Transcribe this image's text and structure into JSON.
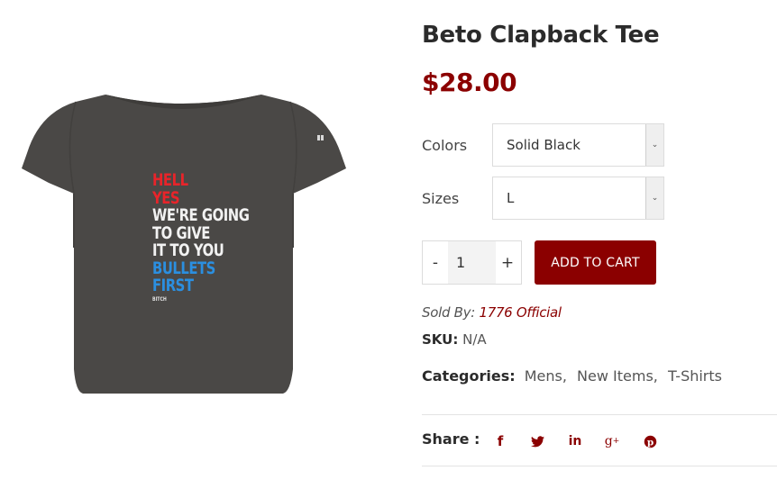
{
  "product": {
    "title": "Beto Clapback Tee",
    "price": "$28.00",
    "shirt_print": {
      "line1": "HELL",
      "line2": "YES",
      "line3": "WE'RE GOING",
      "line4": "TO GIVE",
      "line5": "IT TO YOU",
      "line6": "BULLETS",
      "line7": "FIRST",
      "line8": "BITCH"
    }
  },
  "options": {
    "colors": {
      "label": "Colors",
      "selected": "Solid Black"
    },
    "sizes": {
      "label": "Sizes",
      "selected": "L"
    }
  },
  "cart": {
    "minus": "-",
    "quantity": "1",
    "plus": "+",
    "add_label": "ADD TO CART"
  },
  "meta": {
    "sold_by_label": "Sold By:",
    "vendor": "1776 Official",
    "sku_label": "SKU:",
    "sku_value": "N/A",
    "categories_label": "Categories:",
    "categories": [
      "Mens",
      "New Items",
      "T-Shirts"
    ]
  },
  "share": {
    "label": "Share :",
    "icons": [
      "facebook-icon",
      "twitter-icon",
      "linkedin-icon",
      "google-plus-icon",
      "pinterest-icon"
    ]
  },
  "colors": {
    "accent": "#8b0000",
    "shirt": "#4a4846"
  }
}
